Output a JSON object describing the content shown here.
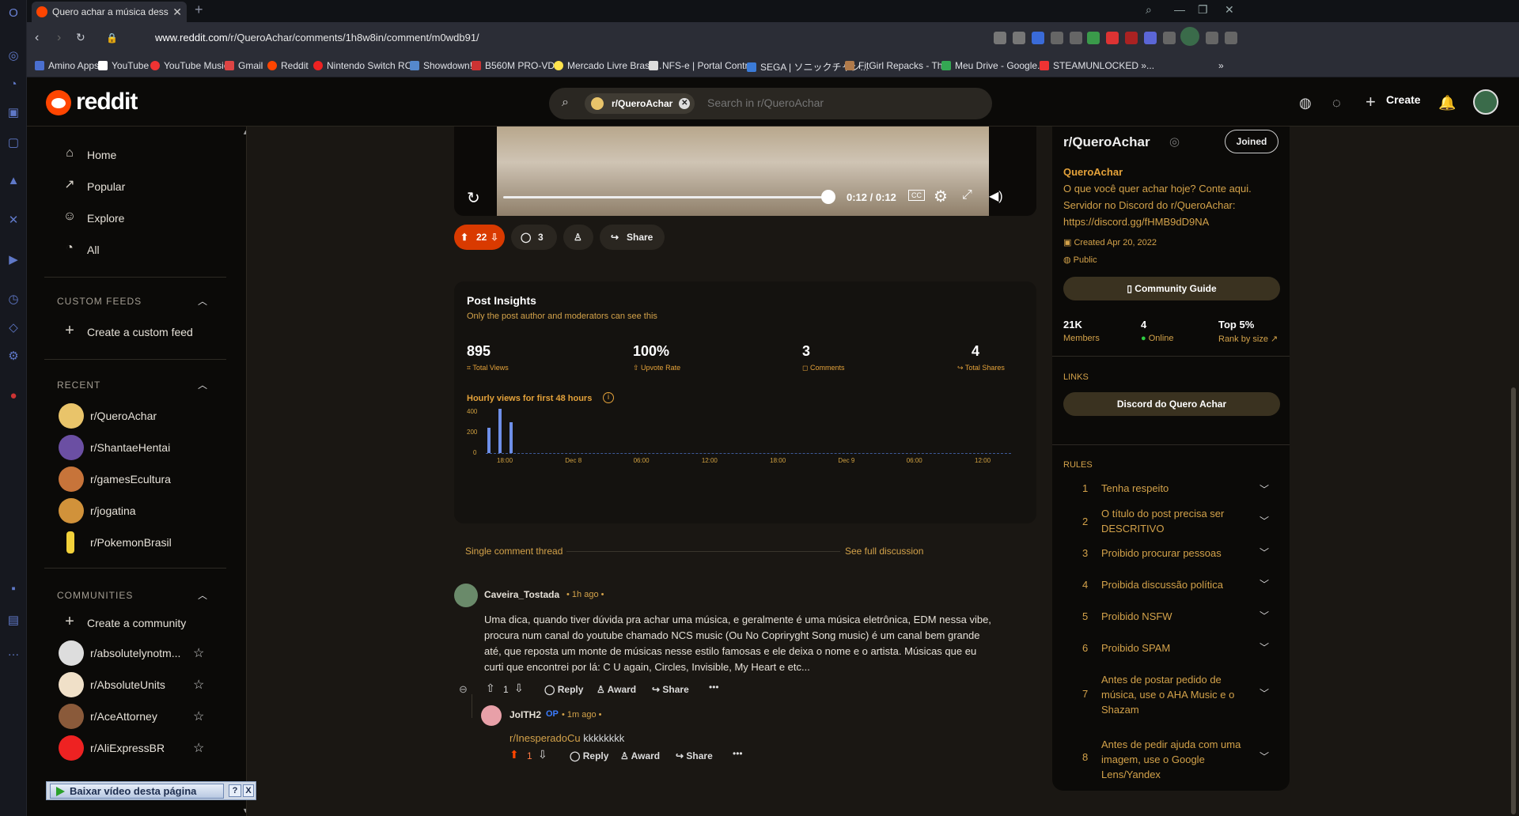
{
  "browser": {
    "tab_title": "Quero achar a música dess",
    "url_host": "www.reddit.com",
    "url_path": "/r/QueroAchar/comments/1h8w8in/comment/m0wdb91/",
    "bookmarks": [
      "Amino Apps",
      "YouTube",
      "YouTube Music",
      "Gmail",
      "Reddit",
      "Nintendo Switch RO...",
      "Showdown!",
      "B560M PRO-VDH",
      "Mercado Livre Brasil...",
      "NFS-e | Portal Contr...",
      "SEGA | ソニックチャン...",
      "FitGirl Repacks - Th...",
      "Meu Drive - Google...",
      "STEAMUNLOCKED »..."
    ]
  },
  "header": {
    "logo": "reddit",
    "search_chip": "r/QueroAchar",
    "search_placeholder": "Search in r/QueroAchar",
    "create_label": "Create"
  },
  "leftnav": {
    "items": [
      "Home",
      "Popular",
      "Explore",
      "All"
    ],
    "custom_feeds_title": "CUSTOM FEEDS",
    "create_feed": "Create a custom feed",
    "recent_title": "RECENT",
    "recent": [
      "r/QueroAchar",
      "r/ShantaeHentai",
      "r/gamesEcultura",
      "r/jogatina",
      "r/PokemonBrasil"
    ],
    "communities_title": "COMMUNITIES",
    "create_community": "Create a community",
    "communities": [
      "r/absolutelynotm...",
      "r/AbsoluteUnits",
      "r/AceAttorney",
      "r/AliExpressBR"
    ]
  },
  "video": {
    "time": "0:12 / 0:12",
    "progress": 1.0
  },
  "actions": {
    "score": "22",
    "comments": "3",
    "share": "Share"
  },
  "insights": {
    "title": "Post Insights",
    "subtitle": "Only the post author and moderators can see this",
    "stats": [
      {
        "value": "895",
        "label": "Total Views"
      },
      {
        "value": "100%",
        "label": "Upvote Rate"
      },
      {
        "value": "3",
        "label": "Comments"
      },
      {
        "value": "4",
        "label": "Total Shares"
      }
    ],
    "chart_title": "Hourly views for first 48 hours"
  },
  "chart_data": {
    "type": "bar",
    "title": "Hourly views for first 48 hours",
    "y_ticks": [
      "400",
      "200",
      "0"
    ],
    "ylim": [
      0,
      400
    ],
    "x_ticks": [
      "18:00",
      "Dec 8",
      "06:00",
      "12:00",
      "18:00",
      "Dec 9",
      "06:00",
      "12:00"
    ],
    "values": [
      230,
      400,
      280,
      0,
      0,
      0,
      0,
      0,
      0,
      0,
      0,
      0,
      0,
      0,
      0,
      0,
      0,
      0,
      0,
      0,
      0,
      0,
      0,
      0,
      0,
      0,
      0,
      0,
      0,
      0,
      0,
      0,
      0,
      0,
      0,
      0,
      0,
      0,
      0,
      0,
      0,
      0,
      0,
      0,
      0,
      0,
      0,
      0
    ]
  },
  "thread": {
    "label": "Single comment thread",
    "see_full": "See full discussion",
    "comment": {
      "author": "Caveira_Tostada",
      "time": "1h ago",
      "lines": [
        "Uma dica, quando tiver dúvida pra achar uma música, e geralmente é uma música eletrônica, EDM nessa vibe,",
        "procura num canal do youtube chamado NCS music (Ou No Copriryght Song music) é um canal bem grande",
        "até, que reposta um monte de músicas nesse estilo famosas e ele deixa o nome e o artista. Músicas que eu",
        "curti que encontrei por lá: C U again, Circles, Invisible, My Heart e etc..."
      ],
      "score": "1",
      "reply": "Reply",
      "award": "Award",
      "share": "Share"
    },
    "reply": {
      "author": "JoITH2",
      "op": "OP",
      "time": "1m ago",
      "mention": "r/InesperadoCu",
      "text": "kkkkkkkk",
      "score": "1",
      "reply": "Reply",
      "award": "Award",
      "share": "Share"
    }
  },
  "sidebar": {
    "name": "r/QueroAchar",
    "joined": "Joined",
    "title": "QueroAchar",
    "desc": [
      "O que você quer achar hoje? Conte aqui.",
      "Servidor no Discord do r/QueroAchar:",
      "https://discord.gg/fHMB9dD9NA"
    ],
    "created": "Created Apr 20, 2022",
    "visibility": "Public",
    "guide": "Community Guide",
    "members": "21K",
    "members_lbl": "Members",
    "online": "4",
    "online_lbl": "Online",
    "rank": "Top 5%",
    "rank_lbl": "Rank by size",
    "links_title": "LINKS",
    "link": "Discord do Quero Achar",
    "rules_title": "RULES",
    "rules": [
      "Tenha respeito",
      "O título do post precisa ser DESCRITIVO",
      "Proibido procurar pessoas",
      "Proibida discussão política",
      "Proibido NSFW",
      "Proibido SPAM",
      "Antes de postar pedido de música, use o AHA Music e o Shazam",
      "Antes de pedir ajuda com uma imagem, use o Google Lens/Yandex"
    ]
  },
  "download_bar": {
    "label": "Baixar vídeo desta página"
  },
  "colors": {
    "accent": "#ff4500",
    "gold": "#d3a24a",
    "bar": "#6e8fe8"
  }
}
